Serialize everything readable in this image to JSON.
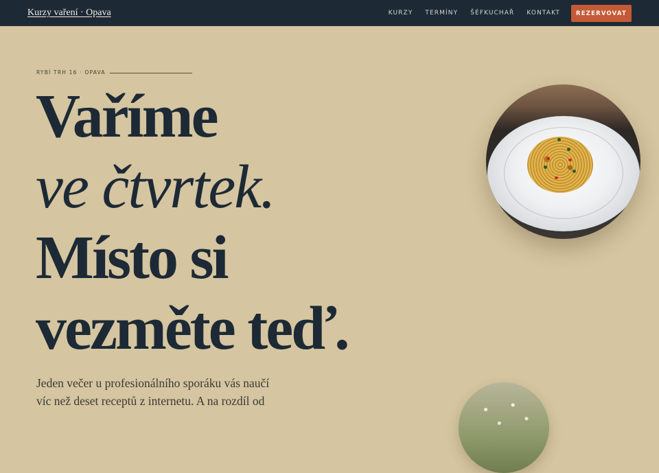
{
  "nav": {
    "brand": "Kurzy vaření · Opava",
    "links": [
      "KURZY",
      "TERMÍNY",
      "ŠÉFKUCHAŘ",
      "KONTAKT"
    ],
    "cta": "REZERVOVAT"
  },
  "hero": {
    "eyebrow": "RYBÍ TRH 16 · OPAVA",
    "title_lines": [
      "Vaříme",
      "ve čtvrtek.",
      "Místo si",
      "vezměte teď."
    ],
    "lead": "Jeden večer u profesionálního sporáku vás naučí víc než deset receptů z internetu. A na rozdíl od"
  },
  "colors": {
    "background": "#d5c5a0",
    "navbar": "#1d2a36",
    "accent": "#c45a37",
    "heading": "#1d2a36"
  },
  "images": {
    "dish": "plate-of-spaghetti-photo",
    "field": "flower-meadow-photo"
  }
}
